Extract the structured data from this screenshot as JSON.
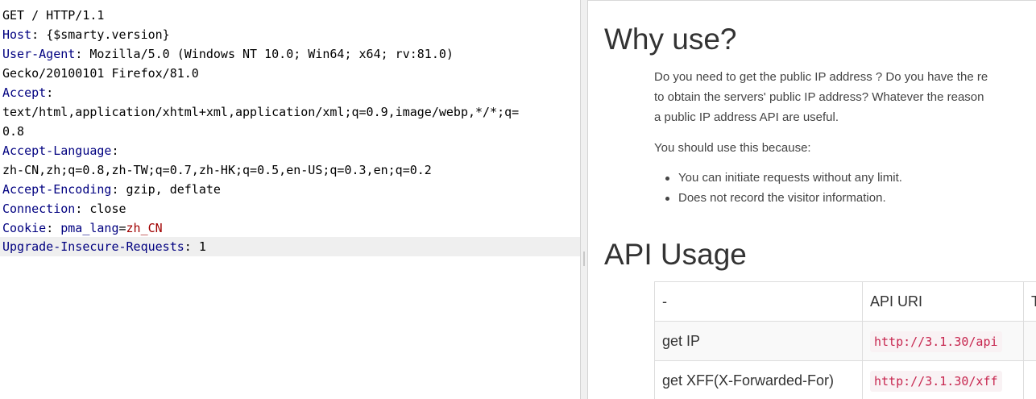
{
  "request": {
    "request_line": "GET / HTTP/1.1",
    "host": {
      "name": "Host",
      "value": "{$smarty.version}"
    },
    "user_agent": {
      "name": "User-Agent",
      "value_line1": "Mozilla/5.0 (Windows NT 10.0; Win64; x64; rv:81.0)",
      "value_line2": "Gecko/20100101 Firefox/81.0"
    },
    "accept": {
      "name": "Accept",
      "value_line1": "text/html,application/xhtml+xml,application/xml;q=0.9,image/webp,*/*;q=",
      "value_line2": "0.8"
    },
    "accept_language": {
      "name": "Accept-Language",
      "value": "zh-CN,zh;q=0.8,zh-TW;q=0.7,zh-HK;q=0.5,en-US;q=0.3,en;q=0.2"
    },
    "accept_encoding": {
      "name": "Accept-Encoding",
      "value": "gzip, deflate"
    },
    "connection": {
      "name": "Connection",
      "value": "close"
    },
    "cookie": {
      "name": "Cookie",
      "cookie_name": "pma_lang",
      "cookie_value": "zh_CN"
    },
    "upgrade": {
      "name": "Upgrade-Insecure-Requests",
      "value": "1"
    }
  },
  "response": {
    "why_heading": "Why use?",
    "para_lines": [
      "Do you need to get the public IP address ? Do you have the re",
      "to obtain the servers' public IP address? Whatever the reason",
      "a public IP address API are useful."
    ],
    "because": "You should use this because:",
    "bullets": [
      "You can initiate requests without any limit.",
      "Does not record the visitor information."
    ],
    "api_heading": "API Usage",
    "table": {
      "headers": [
        "-",
        "API URI",
        "T"
      ],
      "rows": [
        {
          "label": "get IP",
          "uri": "http://3.1.30/api"
        },
        {
          "label": "get XFF(X-Forwarded-For)",
          "uri": "http://3.1.30/xff"
        }
      ]
    }
  },
  "colors": {
    "header_name": "#000080",
    "cookie_value": "#a00000",
    "code_text": "#c7254e",
    "code_bg": "#f9f2f4"
  }
}
